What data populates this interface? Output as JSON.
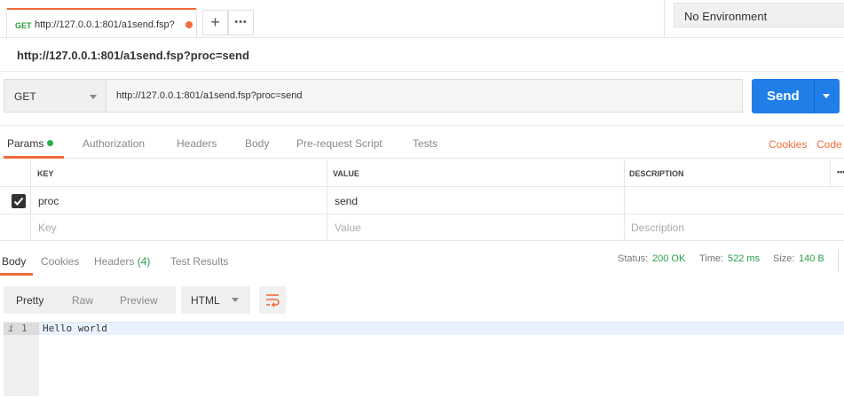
{
  "request_tab": {
    "method": "GET",
    "url": "http://127.0.0.1:801/a1send.fsp?"
  },
  "toolbar": {
    "add_label": "+",
    "more_label": "•••"
  },
  "environment": {
    "selected": "No Environment"
  },
  "request": {
    "title": "http://127.0.0.1:801/a1send.fsp?proc=send",
    "method": "GET",
    "url": "http://127.0.0.1:801/a1send.fsp?proc=send",
    "send_label": "Send"
  },
  "subtabs": {
    "params": "Params",
    "authorization": "Authorization",
    "headers": "Headers",
    "body": "Body",
    "prerequest": "Pre-request Script",
    "tests": "Tests",
    "cookies": "Cookies",
    "code": "Code"
  },
  "params_table": {
    "headers": {
      "key": "KEY",
      "value": "VALUE",
      "description": "DESCRIPTION",
      "more": "•••"
    },
    "rows": [
      {
        "key": "proc",
        "value": "send",
        "description": "",
        "checked": true
      }
    ],
    "placeholders": {
      "key": "Key",
      "value": "Value",
      "description": "Description"
    }
  },
  "response": {
    "tabs": {
      "body": "Body",
      "cookies": "Cookies",
      "headers": "Headers (4)",
      "tests": "Test Results"
    },
    "status_label": "Status:",
    "status_value": "200 OK",
    "time_label": "Time:",
    "time_value": "522 ms",
    "size_label": "Size:",
    "size_value": "140 B",
    "views": {
      "pretty": "Pretty",
      "raw": "Raw",
      "preview": "Preview"
    },
    "format": "HTML",
    "gutter_marker": "i",
    "line_number": "1",
    "content": "Hello world"
  },
  "colors": {
    "accent": "#f26b3a",
    "send": "#1f7ee8",
    "success": "#27a046",
    "method_get": "#2a9d3a"
  }
}
